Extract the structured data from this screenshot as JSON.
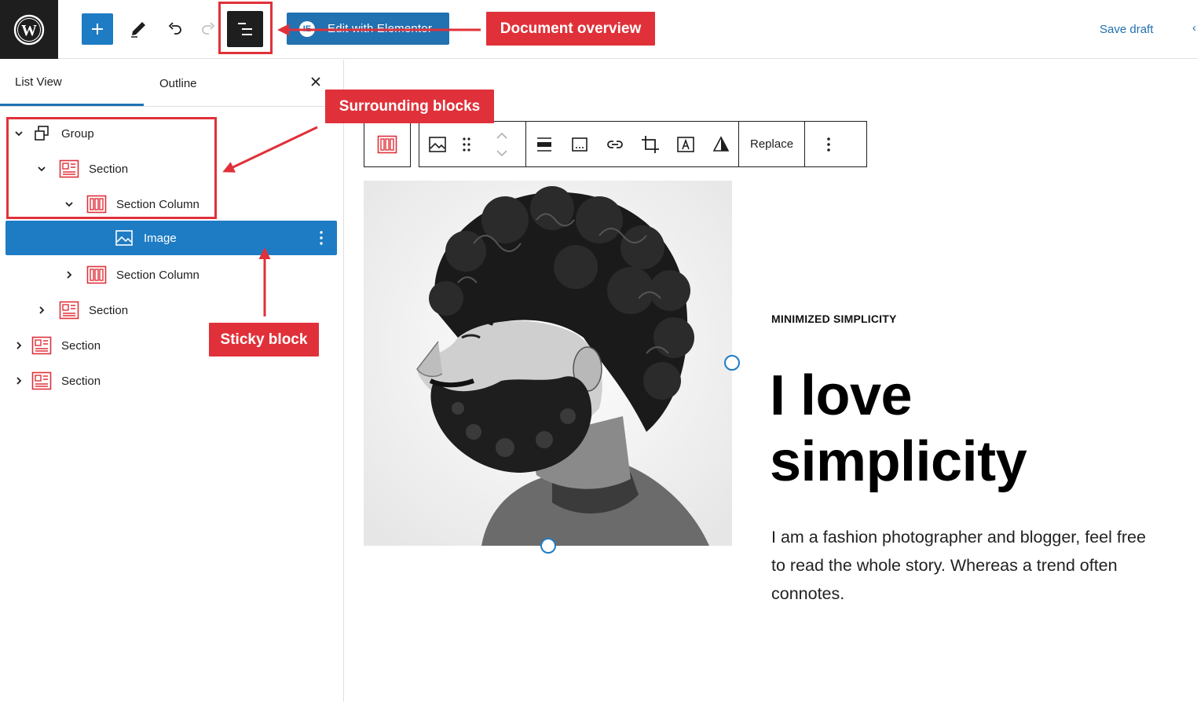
{
  "topbar": {
    "elementor_label": "Edit with Elementor",
    "save_draft": "Save draft",
    "more": "‹"
  },
  "sidebar": {
    "tabs": [
      {
        "label": "List View",
        "active": true
      },
      {
        "label": "Outline",
        "active": false
      }
    ],
    "tree": [
      {
        "label": "Group",
        "level": 1,
        "expanded": true,
        "icon": "group-icon"
      },
      {
        "label": "Section",
        "level": 2,
        "expanded": true,
        "icon": "section-icon"
      },
      {
        "label": "Section Column",
        "level": 3,
        "expanded": true,
        "icon": "column-icon"
      },
      {
        "label": "Image",
        "level": 4,
        "selected": true,
        "icon": "image-icon"
      },
      {
        "label": "Section Column",
        "level": 3,
        "expanded": false,
        "icon": "column-icon"
      },
      {
        "label": "Section",
        "level": 2,
        "expanded": false,
        "icon": "section-icon"
      },
      {
        "label": "Section",
        "level": 1,
        "expanded": false,
        "icon": "section-icon"
      },
      {
        "label": "Section",
        "level": 1,
        "expanded": false,
        "icon": "section-icon"
      }
    ]
  },
  "annotations": {
    "document_overview": "Document overview",
    "surrounding_blocks": "Surrounding blocks",
    "sticky_block": "Sticky block"
  },
  "block_toolbar": {
    "replace_label": "Replace"
  },
  "content": {
    "eyebrow": "MINIMIZED SIMPLICITY",
    "headline_line1": "I love",
    "headline_line2": "simplicity",
    "body": "I am a fashion photographer and blogger, feel free to read the whole story. Whereas a trend often connotes."
  },
  "colors": {
    "accent": "#1e7cc4",
    "annotation": "#e0313a",
    "block_icon": "#e0313a",
    "dark": "#1e1e1e"
  }
}
